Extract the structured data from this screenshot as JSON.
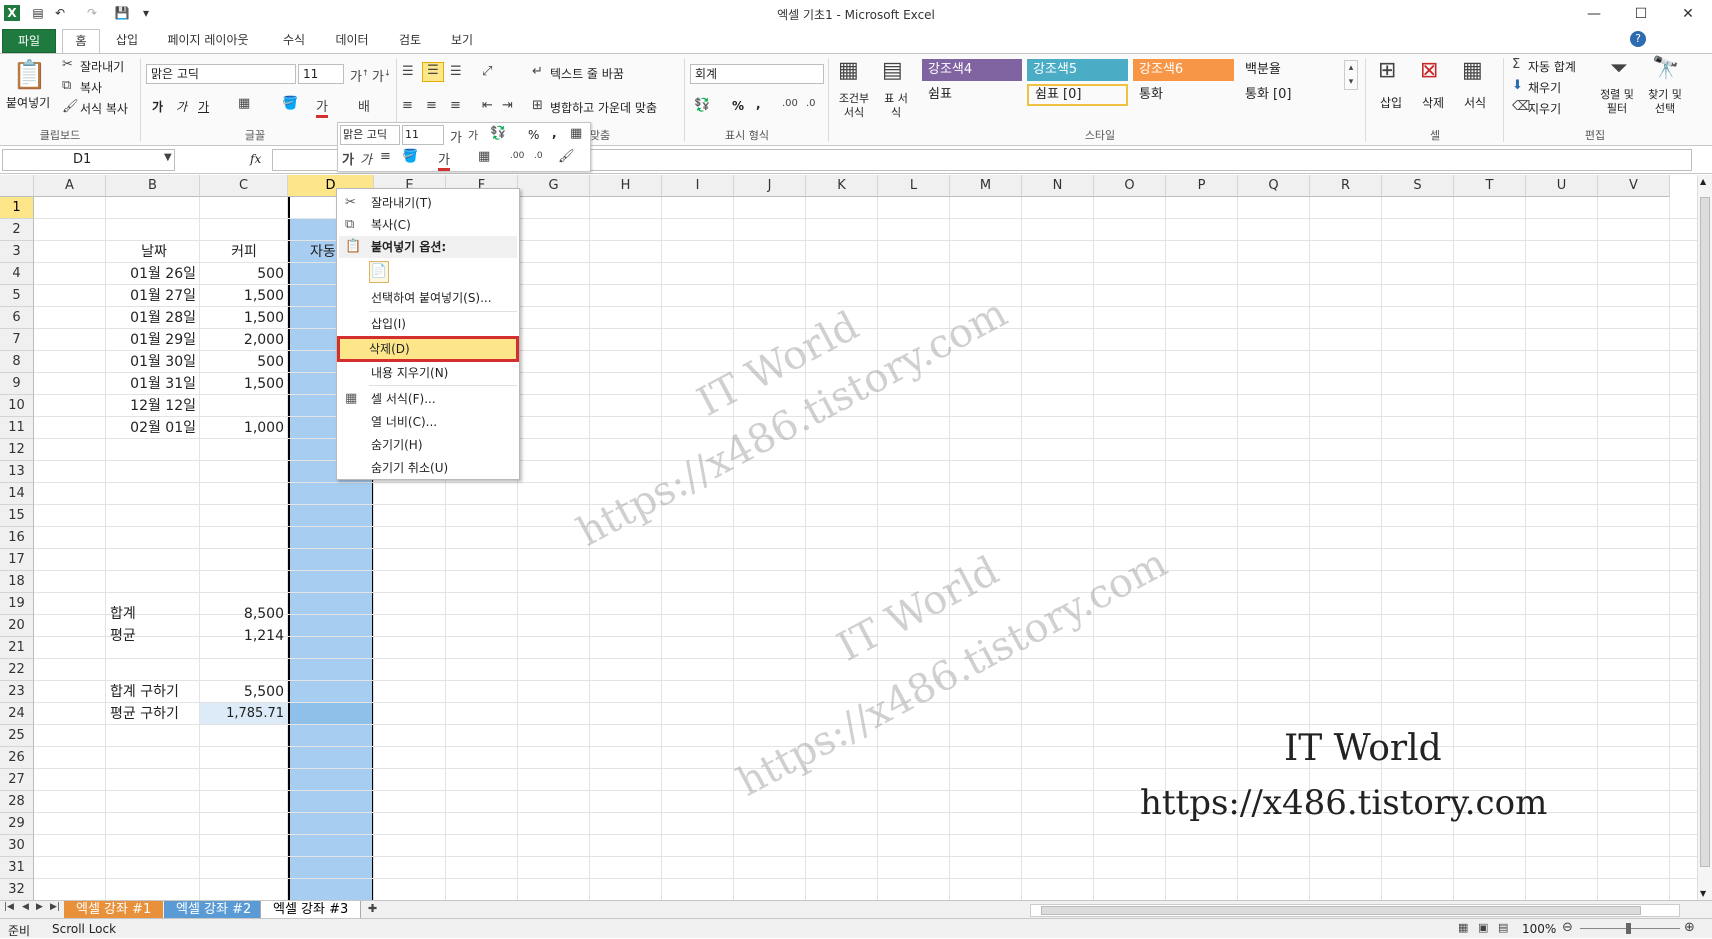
{
  "window": {
    "title": "엑셀 기초1  -  Microsoft Excel",
    "minimize": "—",
    "maximize": "☐",
    "close": "✕"
  },
  "ribbon_tabs": [
    "파일",
    "홈",
    "삽입",
    "페이지 레이아웃",
    "수식",
    "데이터",
    "검토",
    "보기"
  ],
  "clipboard": {
    "paste_label": "붙여넣기",
    "cut": "잘라내기",
    "copy": "복사",
    "format_painter": "서식 복사",
    "group": "클립보드"
  },
  "font": {
    "name": "맑은 고딕",
    "size": "11",
    "bold": "가",
    "italic": "가",
    "underline": "가",
    "group": "글꼴"
  },
  "alignment": {
    "wrap": "텍스트 줄 바꿈",
    "merge": "병합하고 가운데 맞춤",
    "group": "맞춤"
  },
  "number": {
    "format": "회계",
    "percent": "%",
    "comma": ",",
    "group": "표시 형식"
  },
  "styles": {
    "conditional": "조건부 서식",
    "table": "표 서식",
    "cells": [
      {
        "label": "강조색4",
        "bg": "#8064a2",
        "fg": "#ffffff"
      },
      {
        "label": "강조색5",
        "bg": "#4bacc6",
        "fg": "#ffffff"
      },
      {
        "label": "강조색6",
        "bg": "#f79646",
        "fg": "#ffffff"
      },
      {
        "label": "백분율",
        "bg": "#ffffff",
        "fg": "#222222"
      },
      {
        "label": "쉼표",
        "bg": "#ffffff",
        "fg": "#222222"
      },
      {
        "label": "쉼표 [0]",
        "bg": "#ffffff",
        "fg": "#222222"
      },
      {
        "label": "통화",
        "bg": "#ffffff",
        "fg": "#222222"
      },
      {
        "label": "통화 [0]",
        "bg": "#ffffff",
        "fg": "#222222"
      }
    ],
    "group": "스타일"
  },
  "cells_group": {
    "insert": "삽입",
    "delete": "삭제",
    "format": "서식",
    "group": "셀"
  },
  "editing": {
    "autosum": "자동 합계",
    "fill": "채우기",
    "clear": "지우기",
    "sort": "정렬 및 필터",
    "find": "찾기 및 선택",
    "group": "편집"
  },
  "formula_bar": {
    "name_box": "D1",
    "fx": "fx",
    "value": ""
  },
  "mini_toolbar": {
    "font": "맑은 고딕",
    "size": "11",
    "percent": "%",
    "comma": ","
  },
  "columns": [
    "A",
    "B",
    "C",
    "D",
    "E",
    "F",
    "G",
    "H",
    "I",
    "J",
    "K",
    "L",
    "M",
    "N",
    "O",
    "P",
    "Q",
    "R",
    "S",
    "T",
    "U",
    "V"
  ],
  "rows": [
    "1",
    "2",
    "3",
    "4",
    "5",
    "6",
    "7",
    "8",
    "9",
    "10",
    "11",
    "12",
    "13",
    "14",
    "15",
    "16",
    "17",
    "18",
    "19",
    "20",
    "21",
    "22",
    "23",
    "24",
    "25",
    "26",
    "27",
    "28",
    "29",
    "30",
    "31",
    "32"
  ],
  "sheet": {
    "header_date": "날짜",
    "header_coffee": "커피",
    "header_auto": "자동",
    "dates": [
      "01월 26일",
      "01월 27일",
      "01월 28일",
      "01월 29일",
      "01월 30일",
      "01월 31일",
      "12월 12일",
      "02월 01일"
    ],
    "coffee": [
      "500",
      "1,500",
      "1,500",
      "2,000",
      "500",
      "1,500",
      "",
      "1,000"
    ],
    "sum_label": "합계",
    "sum_value": "8,500",
    "avg_label": "평균",
    "avg_value": "1,214",
    "sum_calc_label": "합계 구하기",
    "sum_calc_value": "5,500",
    "avg_calc_label": "평균 구하기",
    "avg_calc_value": "1,785.71"
  },
  "context_menu": {
    "cut": "잘라내기(T)",
    "copy": "복사(C)",
    "paste_options": "붙여넣기 옵션:",
    "paste_special": "선택하여 붙여넣기(S)...",
    "insert": "삽입(I)",
    "delete": "삭제(D)",
    "clear": "내용 지우기(N)",
    "format_cells": "셀 서식(F)...",
    "col_width": "열 너비(C)...",
    "hide": "숨기기(H)",
    "unhide": "숨기기 취소(U)"
  },
  "watermark": {
    "name": "IT World",
    "url": "https://x486.tistory.com"
  },
  "sheet_tabs": [
    "엑셀 강좌 #1",
    "엑셀 강좌 #2",
    "엑셀 강좌 #3"
  ],
  "status": {
    "ready": "준비",
    "scroll_lock": "Scroll Lock",
    "zoom": "100%"
  },
  "colors": {
    "excel_green": "#1f7a3f",
    "selection": "#a7cdf0",
    "highlight_box": "#d32f2f",
    "menu_hover": "#fde68a"
  }
}
